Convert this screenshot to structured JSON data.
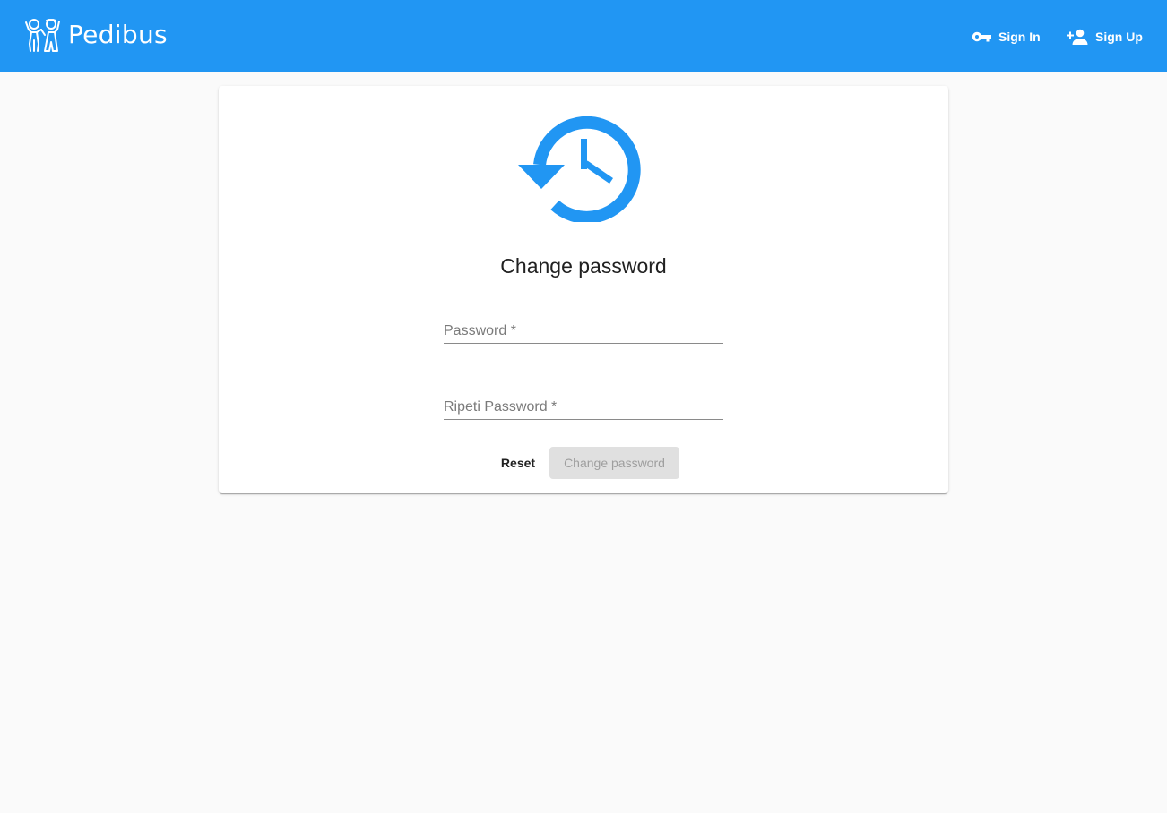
{
  "app": {
    "name": "Pedibus",
    "primary_color": "#2196f3",
    "logo_icon": "children-icon"
  },
  "nav": {
    "sign_in": {
      "label": "Sign In",
      "icon": "key-icon"
    },
    "sign_up": {
      "label": "Sign Up",
      "icon": "person-add-icon"
    }
  },
  "card": {
    "icon": "restore-icon",
    "title": "Change password",
    "fields": {
      "password": {
        "placeholder": "Password *",
        "value": ""
      },
      "repeat_password": {
        "placeholder": "Ripeti Password *",
        "value": ""
      }
    },
    "actions": {
      "reset": "Reset",
      "submit": "Change password",
      "submit_disabled": true
    }
  }
}
